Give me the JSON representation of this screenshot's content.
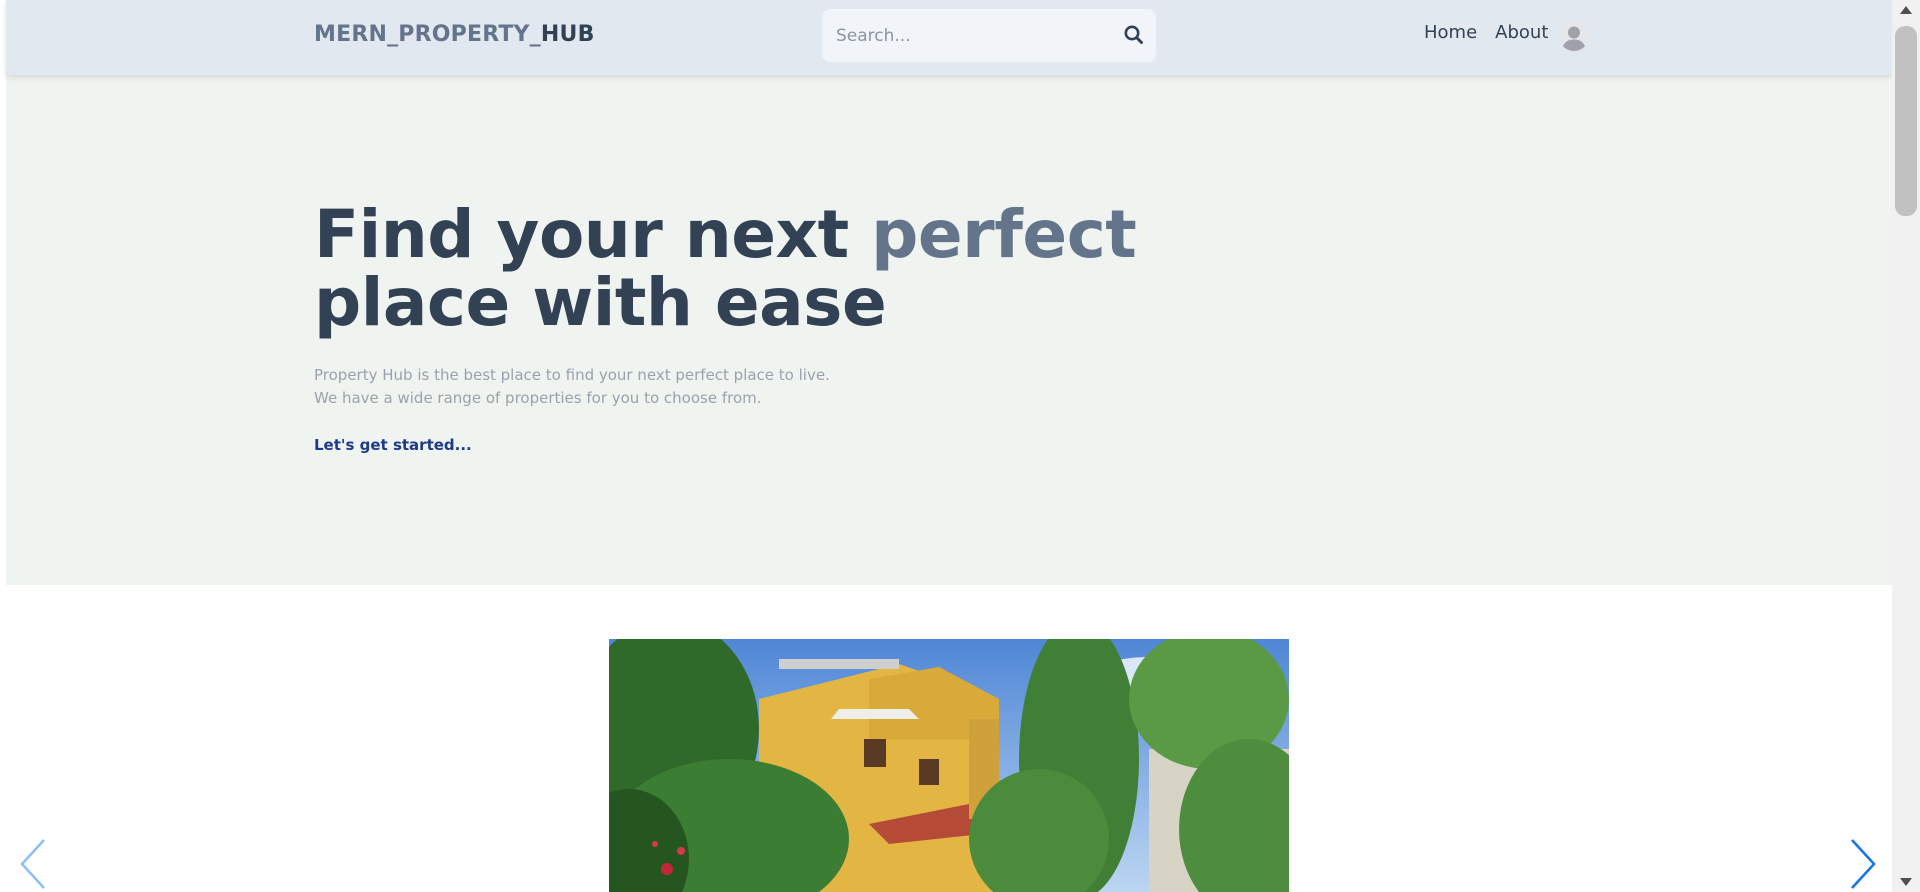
{
  "header": {
    "logo_part1": "MERN_PROPERTY_",
    "logo_part2": "HUB",
    "search_placeholder": "Search...",
    "nav": [
      {
        "label": "Home"
      },
      {
        "label": "About"
      }
    ]
  },
  "hero": {
    "title_line1_a": "Find your next ",
    "title_line1_b": "perfect",
    "title_line2": "place with ease",
    "subtitle_line1": "Property Hub is the best place to find your next perfect place to live.",
    "subtitle_line2": "We have a wide range of properties for you to choose from.",
    "cta": "Let's get started..."
  },
  "slider": {
    "image": "house-photo",
    "prev_icon": "chevron-left-icon",
    "next_icon": "chevron-right-icon"
  },
  "colors": {
    "header_bg": "#e2e8f0",
    "hero_bg": "#f0f4f1",
    "title": "#334155",
    "accent": "#64748b",
    "cta": "#1e3a8a",
    "arrow": "#1a73e8"
  }
}
